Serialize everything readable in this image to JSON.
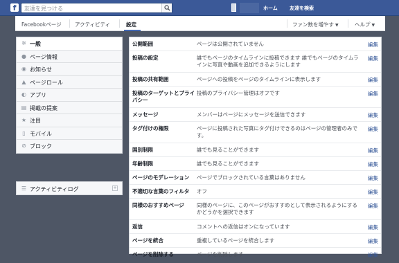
{
  "topbar": {
    "logo": "f",
    "search_placeholder": "友達を見つける",
    "home": "ホーム",
    "find_friends": "友達を検索"
  },
  "subnav": {
    "tabs": [
      "Facebookページ",
      "アクティビティ",
      "設定"
    ],
    "grow_fans": "ファン数を増やす",
    "help": "ヘルプ"
  },
  "sidebar": {
    "items": [
      {
        "label": "一般",
        "icon": "gear-icon"
      },
      {
        "label": "ページ情報",
        "icon": "info-icon"
      },
      {
        "label": "お知らせ",
        "icon": "globe-icon"
      },
      {
        "label": "ページロール",
        "icon": "person-icon"
      },
      {
        "label": "アプリ",
        "icon": "apps-icon"
      },
      {
        "label": "掲載の提案",
        "icon": "list-icon"
      },
      {
        "label": "注目",
        "icon": "star-icon"
      },
      {
        "label": "モバイル",
        "icon": "mobile-icon"
      },
      {
        "label": "ブロック",
        "icon": "block-icon"
      }
    ],
    "activity_log": "アクティビティログ"
  },
  "settings": {
    "edit_label": "編集",
    "rows": [
      {
        "label": "公開範囲",
        "desc": "ページは公開されていません"
      },
      {
        "label": "投稿の設定",
        "desc": "誰でもページのタイムラインに投稿できます 誰でもページのタイムラインに写真や動画を追加できるようにします"
      },
      {
        "label": "投稿の共有範囲",
        "desc": "ページへの投稿をページのタイムラインに表示します"
      },
      {
        "label": "投稿のターゲットとプライバシー",
        "desc": "投稿のプライバシー管理はオフです"
      },
      {
        "label": "メッセージ",
        "desc": "メンバーはページにメッセージを送信できます"
      },
      {
        "label": "タグ付けの権限",
        "desc": "ページに投稿された写真にタグ付けできるのはページの管理者のみです。"
      },
      {
        "label": "国別制限",
        "desc": "誰でも見ることができます"
      },
      {
        "label": "年齢制限",
        "desc": "誰でも見ることができます"
      },
      {
        "label": "ページのモデレーション",
        "desc": "ページでブロックされている言葉はありません"
      },
      {
        "label": "不適切な言葉のフィルタ",
        "desc": "オフ"
      },
      {
        "label": "同様のおすすめページ",
        "desc": "同様のページに、このページがおすすめとして表示されるようにするかどうかを選択できます"
      },
      {
        "label": "返信",
        "desc": "コメントへの返信はオンになっています"
      },
      {
        "label": "ページを統合",
        "desc": "重複しているページを統合します"
      },
      {
        "label": "ページを削除する",
        "desc": "ページを削除します"
      }
    ]
  }
}
